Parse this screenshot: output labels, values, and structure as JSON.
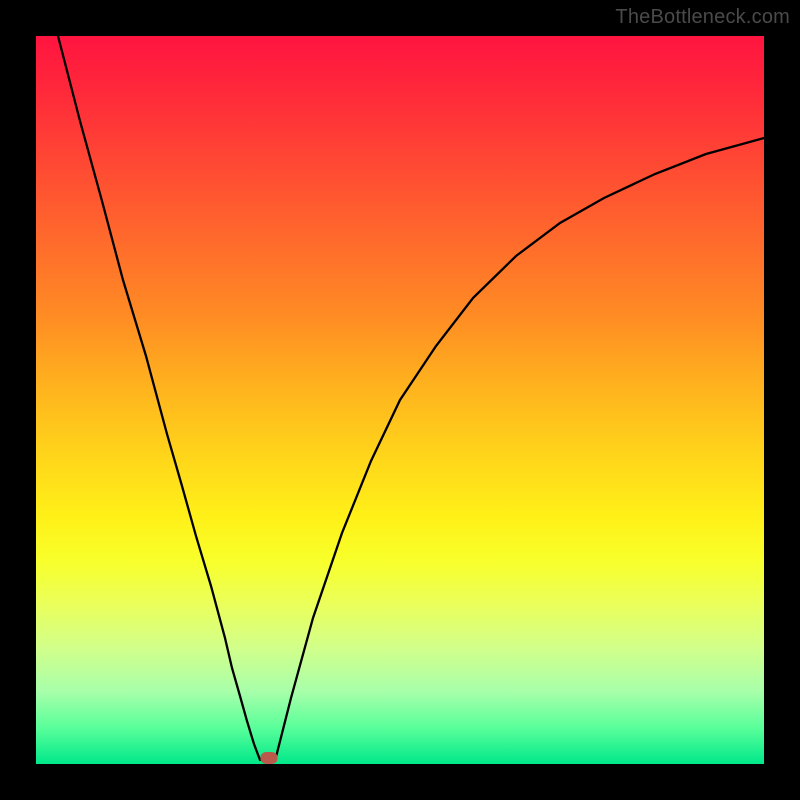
{
  "watermark": "TheBottleneck.com",
  "chart_data": {
    "type": "line",
    "title": "",
    "xlabel": "",
    "ylabel": "",
    "xlim": [
      0,
      100
    ],
    "ylim": [
      0,
      100
    ],
    "series": [
      {
        "name": "left-branch",
        "x": [
          3,
          6,
          9,
          12,
          15,
          18,
          20,
          22,
          24,
          26,
          27,
          28,
          29,
          30,
          30.8
        ],
        "values": [
          100,
          88,
          77,
          66,
          56,
          45,
          38,
          31,
          24,
          17,
          13,
          9,
          6,
          3,
          0.5
        ]
      },
      {
        "name": "right-branch",
        "x": [
          33,
          35,
          38,
          42,
          46,
          50,
          55,
          60,
          66,
          72,
          78,
          85,
          92,
          100
        ],
        "values": [
          1,
          9,
          20,
          32,
          42,
          50,
          58,
          64,
          70,
          74,
          78,
          81,
          84,
          86
        ]
      }
    ],
    "marker": {
      "x": 32,
      "bottleneck_pct": 0.5
    },
    "gradient_stops": [
      {
        "pos": 0,
        "color": "#ff1440"
      },
      {
        "pos": 50,
        "color": "#ffd61a"
      },
      {
        "pos": 100,
        "color": "#00e88a"
      }
    ]
  }
}
